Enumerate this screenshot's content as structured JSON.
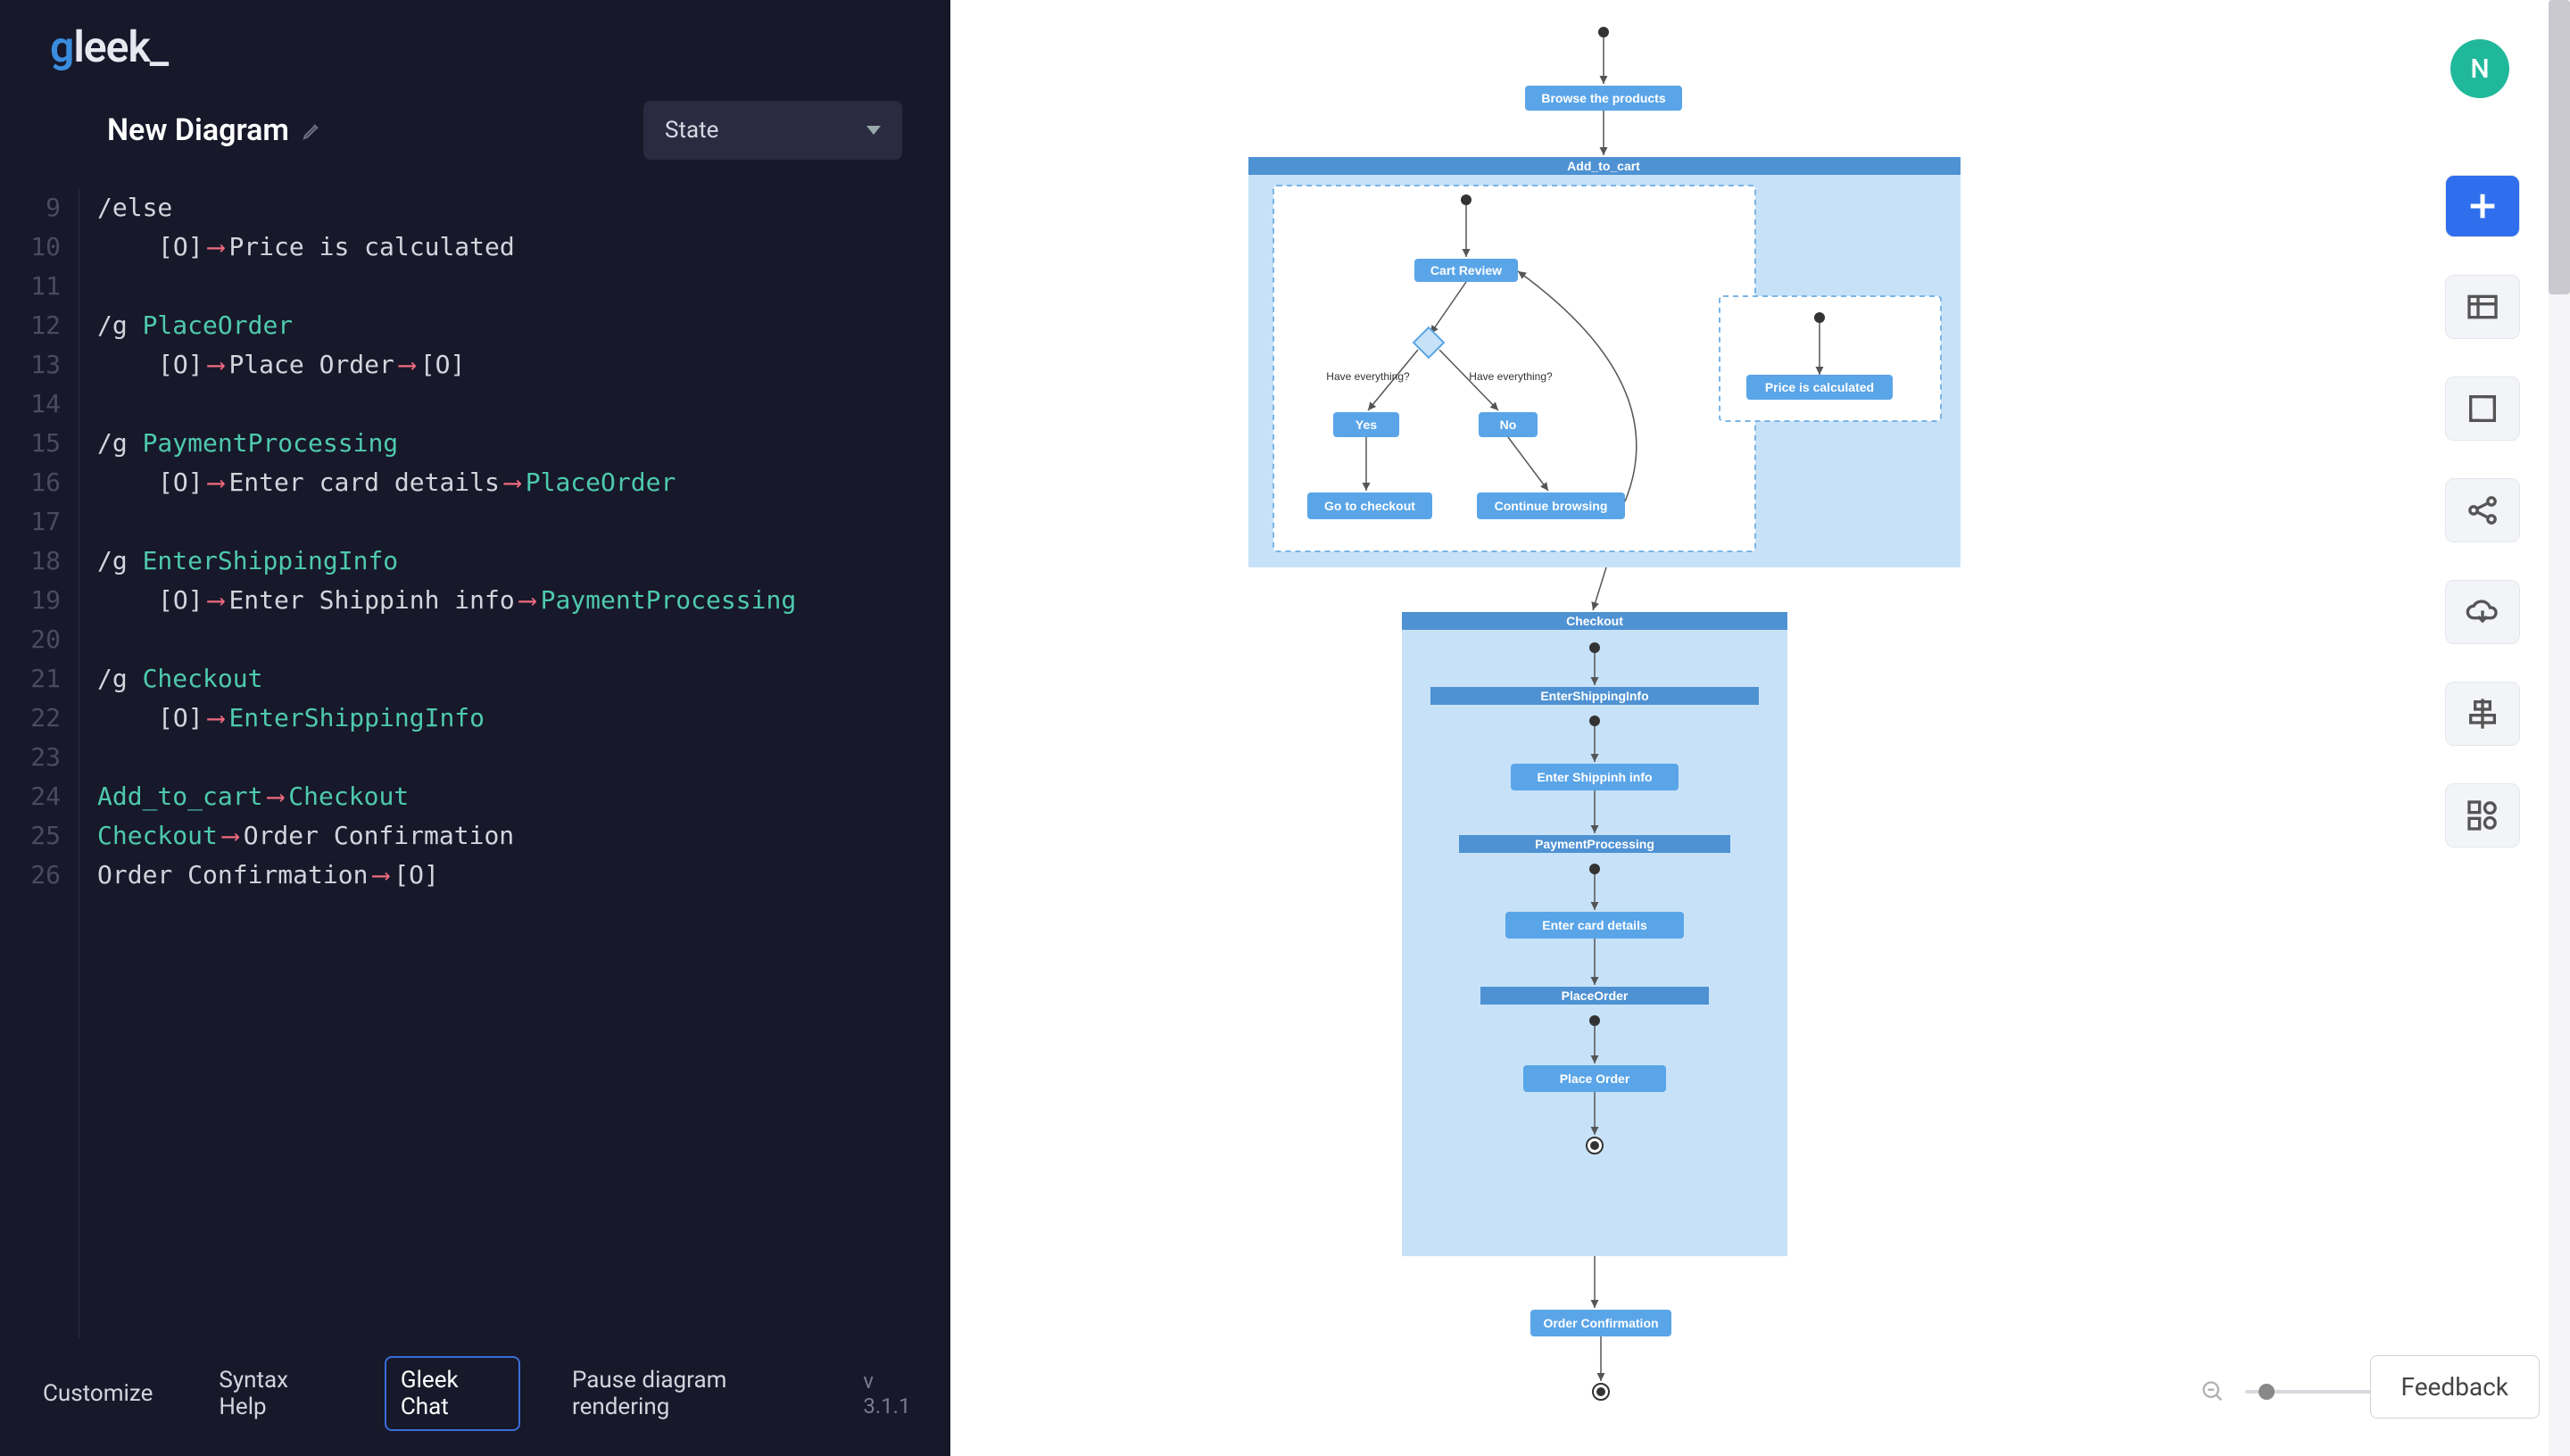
{
  "logo": {
    "g": "g",
    "rest": "leek_"
  },
  "title": "New Diagram",
  "diagram_type": "State",
  "avatar_initial": "N",
  "footer": {
    "customize": "Customize",
    "syntax_help": "Syntax Help",
    "gleek_chat": "Gleek Chat",
    "pause_render": "Pause diagram rendering",
    "version": "v 3.1.1"
  },
  "feedback": "Feedback",
  "code_lines": [
    {
      "n": 9,
      "indent": 1,
      "segs": [
        {
          "t": "slash",
          "v": "/else"
        }
      ]
    },
    {
      "n": 10,
      "indent": 2,
      "segs": [
        {
          "t": "br",
          "v": "[O]"
        },
        {
          "t": "sp"
        },
        {
          "t": "arrow"
        },
        {
          "t": "sp"
        },
        {
          "t": "txt",
          "v": "Price is calculated"
        }
      ]
    },
    {
      "n": 11,
      "indent": 1,
      "segs": []
    },
    {
      "n": 12,
      "indent": 1,
      "segs": [
        {
          "t": "slash",
          "v": "/g "
        },
        {
          "t": "green",
          "v": "PlaceOrder"
        }
      ]
    },
    {
      "n": 13,
      "indent": 2,
      "segs": [
        {
          "t": "br",
          "v": "[O]"
        },
        {
          "t": "sp"
        },
        {
          "t": "arrow"
        },
        {
          "t": "sp"
        },
        {
          "t": "txt",
          "v": "Place Order"
        },
        {
          "t": "sp"
        },
        {
          "t": "arrow"
        },
        {
          "t": "sp"
        },
        {
          "t": "br",
          "v": "[O]"
        }
      ]
    },
    {
      "n": 14,
      "indent": 1,
      "segs": []
    },
    {
      "n": 15,
      "indent": 1,
      "segs": [
        {
          "t": "slash",
          "v": "/g "
        },
        {
          "t": "green",
          "v": "PaymentProcessing"
        }
      ]
    },
    {
      "n": 16,
      "indent": 2,
      "segs": [
        {
          "t": "br",
          "v": "[O]"
        },
        {
          "t": "sp"
        },
        {
          "t": "arrow"
        },
        {
          "t": "sp"
        },
        {
          "t": "txt",
          "v": "Enter card details"
        },
        {
          "t": "sp"
        },
        {
          "t": "arrow"
        },
        {
          "t": "sp"
        },
        {
          "t": "green",
          "v": "PlaceOrder"
        }
      ]
    },
    {
      "n": 17,
      "indent": 1,
      "segs": []
    },
    {
      "n": 18,
      "indent": 1,
      "segs": [
        {
          "t": "slash",
          "v": "/g "
        },
        {
          "t": "green",
          "v": "EnterShippingInfo"
        }
      ]
    },
    {
      "n": 19,
      "indent": 2,
      "segs": [
        {
          "t": "br",
          "v": "[O]"
        },
        {
          "t": "sp"
        },
        {
          "t": "arrow"
        },
        {
          "t": "sp"
        },
        {
          "t": "txt",
          "v": "Enter Shippinh info"
        },
        {
          "t": "sp"
        },
        {
          "t": "arrow"
        },
        {
          "t": "sp"
        },
        {
          "t": "green",
          "v": "PaymentProcessing"
        }
      ]
    },
    {
      "n": 20,
      "indent": 1,
      "segs": []
    },
    {
      "n": 21,
      "indent": 1,
      "segs": [
        {
          "t": "slash",
          "v": "/g "
        },
        {
          "t": "green",
          "v": "Checkout"
        }
      ]
    },
    {
      "n": 22,
      "indent": 2,
      "segs": [
        {
          "t": "br",
          "v": "[O]"
        },
        {
          "t": "sp"
        },
        {
          "t": "arrow"
        },
        {
          "t": "sp"
        },
        {
          "t": "green",
          "v": "EnterShippingInfo"
        }
      ]
    },
    {
      "n": 23,
      "indent": 1,
      "segs": []
    },
    {
      "n": 24,
      "indent": 1,
      "segs": [
        {
          "t": "green",
          "v": "Add_to_cart"
        },
        {
          "t": "arrow"
        },
        {
          "t": "green",
          "v": "Checkout"
        }
      ]
    },
    {
      "n": 25,
      "indent": 1,
      "segs": [
        {
          "t": "green",
          "v": "Checkout"
        },
        {
          "t": "arrow"
        },
        {
          "t": "txt",
          "v": "Order Confirmation"
        }
      ]
    },
    {
      "n": 26,
      "indent": 1,
      "segs": [
        {
          "t": "txt",
          "v": "Order Confirmation"
        },
        {
          "t": "arrow"
        },
        {
          "t": "br",
          "v": "[O]"
        }
      ]
    }
  ],
  "diagram": {
    "browse": "Browse the products",
    "add_to_cart": "Add_to_cart",
    "cart_review": "Cart Review",
    "q_left": "Have everything?",
    "q_right": "Have everything?",
    "yes": "Yes",
    "no": "No",
    "go_checkout": "Go to checkout",
    "continue_browsing": "Continue browsing",
    "price_calc": "Price is calculated",
    "checkout": "Checkout",
    "enter_shipping": "EnterShippingInfo",
    "enter_shipping_state": "Enter Shippinh info",
    "payment_processing": "PaymentProcessing",
    "enter_card": "Enter card details",
    "place_order_grp": "PlaceOrder",
    "place_order_state": "Place Order",
    "order_confirmation": "Order Confirmation"
  }
}
